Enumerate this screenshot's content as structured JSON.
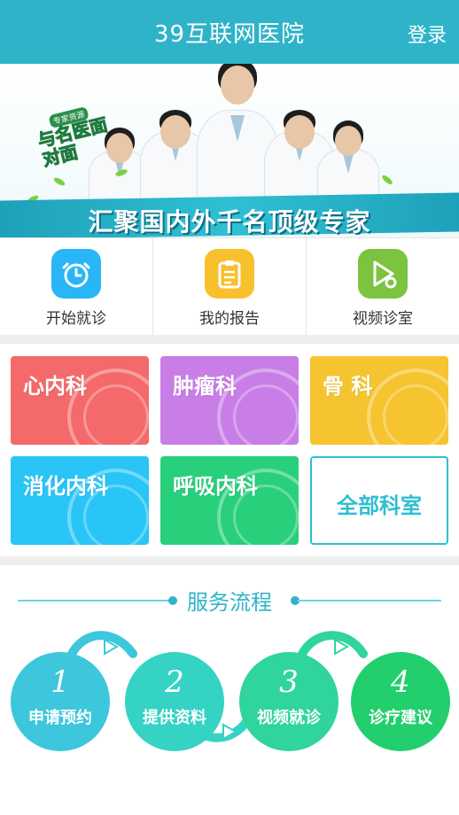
{
  "header": {
    "title": "39互联网医院",
    "login": "登录",
    "color": "#2fb3c9"
  },
  "banner": {
    "badge_small": "专家资源",
    "badge_big": "与名医面对面",
    "slogan": "汇聚国内外千名顶级专家"
  },
  "quick_actions": [
    {
      "label": "开始就诊",
      "icon": "alarm-clock-icon",
      "color": "#29b6f6"
    },
    {
      "label": "我的报告",
      "icon": "clipboard-icon",
      "color": "#f9c02d"
    },
    {
      "label": "视频诊室",
      "icon": "video-play-icon",
      "color": "#7cc340"
    }
  ],
  "departments": [
    {
      "label": "心内科",
      "icon": "heart-icon",
      "color": "#f46a6a"
    },
    {
      "label": "肿瘤科",
      "icon": "mri-scanner-icon",
      "color": "#c87ee6"
    },
    {
      "label": "骨 科",
      "icon": "knee-joint-icon",
      "color": "#f5c430"
    },
    {
      "label": "消化内科",
      "icon": "stomach-icon",
      "color": "#29c5f6"
    },
    {
      "label": "呼吸内科",
      "icon": "lungs-icon",
      "color": "#28d07c"
    },
    {
      "label": "全部科室",
      "icon": "",
      "color": "#2dbfd2"
    }
  ],
  "service_flow": {
    "title": "服务流程",
    "steps": [
      {
        "num": "1",
        "label": "申请预约",
        "color": "#3cc7dc"
      },
      {
        "num": "2",
        "label": "提供资料",
        "color": "#34d3c4"
      },
      {
        "num": "3",
        "label": "视频就诊",
        "color": "#2fd59a"
      },
      {
        "num": "4",
        "label": "诊疗建议",
        "color": "#22cf6c"
      }
    ]
  }
}
